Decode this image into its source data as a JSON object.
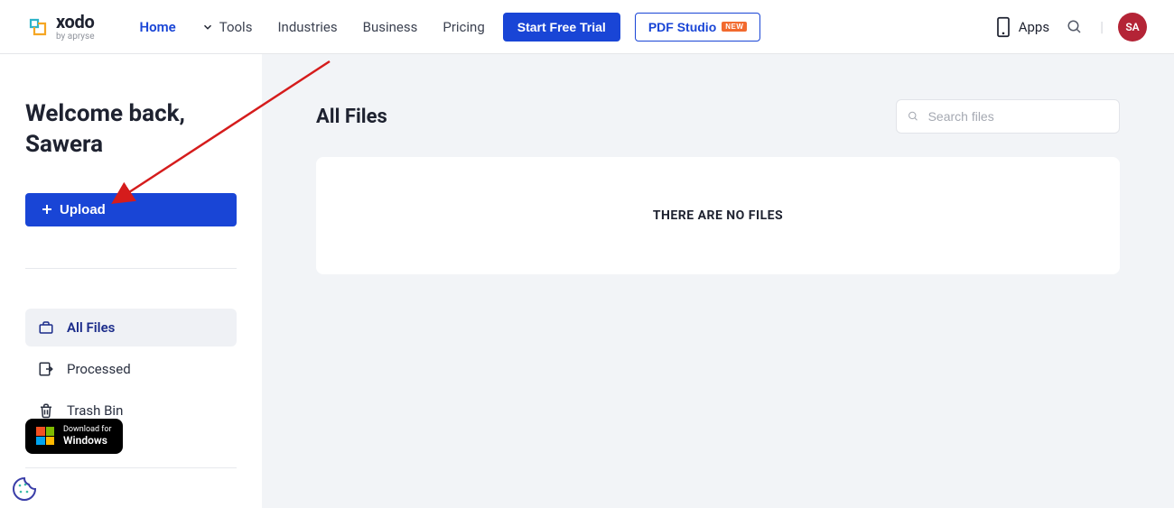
{
  "brand": {
    "name": "xodo",
    "sub": "by apryse"
  },
  "nav": {
    "home": "Home",
    "tools": "Tools",
    "industries": "Industries",
    "business": "Business",
    "pricing": "Pricing"
  },
  "cta": {
    "trial": "Start Free Trial",
    "studio": "PDF Studio",
    "studio_badge": "NEW"
  },
  "header": {
    "apps": "Apps",
    "avatar_initials": "SA"
  },
  "sidebar": {
    "welcome_line1": "Welcome back,",
    "welcome_line2": "Sawera",
    "upload": "Upload",
    "items": [
      {
        "label": "All Files"
      },
      {
        "label": "Processed"
      },
      {
        "label": "Trash Bin"
      }
    ],
    "download": {
      "small": "Download for",
      "big": "Windows"
    }
  },
  "main": {
    "title": "All Files",
    "search_placeholder": "Search files",
    "empty": "THERE ARE NO FILES"
  }
}
